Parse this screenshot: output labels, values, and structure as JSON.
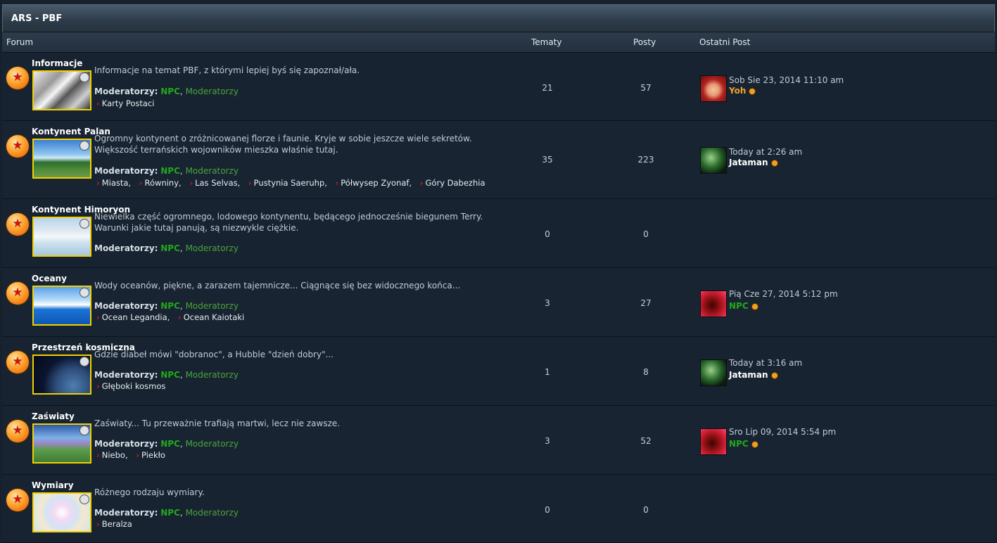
{
  "category": {
    "title": "ARS - PBF"
  },
  "headers": {
    "forum": "Forum",
    "topics": "Tematy",
    "posts": "Posty",
    "last_post": "Ostatni Post"
  },
  "colors": {
    "moderator_npc": "#22a81a",
    "moderator_group": "#4aa43a",
    "user_yoh": "#f2a32a",
    "user_jataman": "#ffffff",
    "user_npc": "#22a81a",
    "thumb_border": "#f1d000"
  },
  "mods_label": "Moderatorzy:",
  "mods_npc": "NPC",
  "mods_group": "Moderatorzy",
  "forums": [
    {
      "name": "Informacje",
      "desc": "Informacje na temat PBF, z którymi lepiej byś się zapoznał/ała.",
      "subforums": [
        "Karty Postaci"
      ],
      "topics": "21",
      "posts": "57",
      "last_post": {
        "date": "Sob Sie 23, 2014 11:10 am",
        "user": "Yoh"
      }
    },
    {
      "name": "Kontynent Palan",
      "desc": "Ogromny kontynent o zróżnicowanej florze i faunie. Kryje w sobie jeszcze wiele sekretów. Większość terrańskich wojowników mieszka właśnie tutaj.",
      "subforums": [
        "Miasta,",
        "Równiny,",
        "Las Selvas,",
        "Pustynia Saeruhp,",
        "Półwysep Zyonaf,",
        "Góry Dabezhia"
      ],
      "topics": "35",
      "posts": "223",
      "last_post": {
        "date": "Today at 2:26 am",
        "user": "Jataman"
      }
    },
    {
      "name": "Kontynent Himoryon",
      "desc": "Niewielka część ogromnego, lodowego kontynentu, będącego jednocześnie biegunem Terry. Warunki jakie tutaj panują, są niezwykle ciężkie.",
      "subforums": [],
      "topics": "0",
      "posts": "0",
      "last_post": null
    },
    {
      "name": "Oceany",
      "desc": "Wody oceanów, piękne, a zarazem tajemnicze... Ciągnące się bez widocznego końca...",
      "subforums": [
        "Ocean Legandia,",
        "Ocean Kaiotaki"
      ],
      "topics": "3",
      "posts": "27",
      "last_post": {
        "date": "Pią Cze 27, 2014 5:12 pm",
        "user": "NPC"
      }
    },
    {
      "name": "Przestrzeń kosmiczna",
      "desc": "Gdzie diabeł mówi \"dobranoc\", a Hubble \"dzień dobry\"...",
      "subforums": [
        "Głęboki kosmos"
      ],
      "topics": "1",
      "posts": "8",
      "last_post": {
        "date": "Today at 3:16 am",
        "user": "Jataman"
      }
    },
    {
      "name": "Zaświaty",
      "desc": "Zaświaty... Tu przeważnie trafiają martwi, lecz nie zawsze.",
      "subforums": [
        "Niebo,",
        "Piekło"
      ],
      "topics": "3",
      "posts": "52",
      "last_post": {
        "date": "Sro Lip 09, 2014 5:54 pm",
        "user": "NPC"
      }
    },
    {
      "name": "Wymiary",
      "desc": "Różnego rodzaju wymiary.",
      "subforums": [
        "Beralza"
      ],
      "topics": "0",
      "posts": "0",
      "last_post": null
    }
  ]
}
